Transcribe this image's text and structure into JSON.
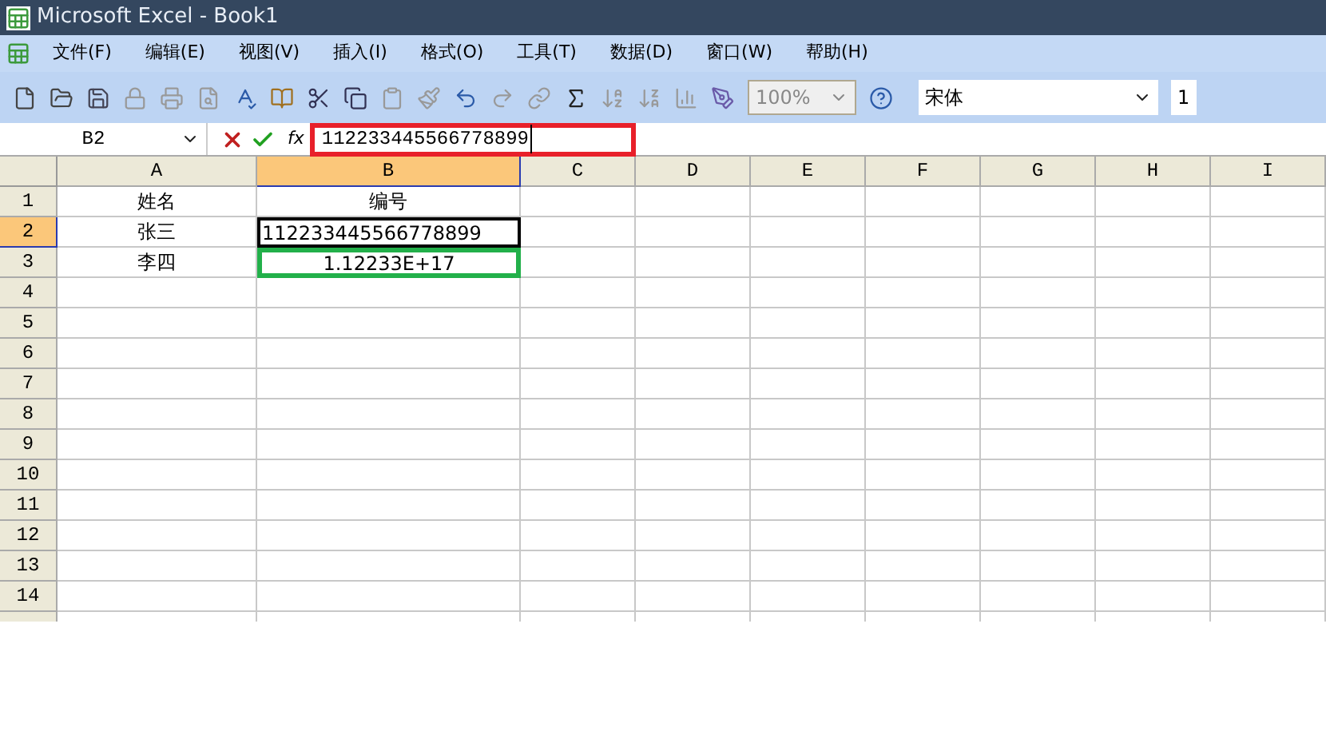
{
  "window": {
    "title": "Microsoft Excel - Book1"
  },
  "menu": [
    "文件(F)",
    "编辑(E)",
    "视图(V)",
    "插入(I)",
    "格式(O)",
    "工具(T)",
    "数据(D)",
    "窗口(W)",
    "帮助(H)"
  ],
  "toolbar": {
    "zoom": "100%",
    "font": "宋体",
    "font_size": "1"
  },
  "formula_bar": {
    "name_box": "B2",
    "fx": "fx",
    "value": "112233445566778899",
    "highlighted": true
  },
  "columns": [
    {
      "label": "A",
      "selected": false
    },
    {
      "label": "B",
      "selected": true
    },
    {
      "label": "C",
      "selected": false
    },
    {
      "label": "D",
      "selected": false
    },
    {
      "label": "E",
      "selected": false
    },
    {
      "label": "F",
      "selected": false
    },
    {
      "label": "G",
      "selected": false
    },
    {
      "label": "H",
      "selected": false
    },
    {
      "label": "I",
      "selected": false
    }
  ],
  "rows": [
    {
      "label": "1",
      "selected": false,
      "cells": [
        {
          "text": "姓名"
        },
        {
          "text": "编号"
        }
      ]
    },
    {
      "label": "2",
      "selected": true,
      "cells": [
        {
          "text": "张三"
        },
        {
          "text": "112233445566778899",
          "active": true
        }
      ]
    },
    {
      "label": "3",
      "selected": false,
      "cells": [
        {
          "text": "李四"
        },
        {
          "text": "1.12233E+17",
          "highlighted": true
        }
      ]
    },
    {
      "label": "4",
      "selected": false,
      "cells": []
    },
    {
      "label": "5",
      "selected": false,
      "cells": []
    },
    {
      "label": "6",
      "selected": false,
      "cells": []
    },
    {
      "label": "7",
      "selected": false,
      "cells": []
    },
    {
      "label": "8",
      "selected": false,
      "cells": []
    },
    {
      "label": "9",
      "selected": false,
      "cells": []
    },
    {
      "label": "10",
      "selected": false,
      "cells": []
    },
    {
      "label": "11",
      "selected": false,
      "cells": []
    },
    {
      "label": "12",
      "selected": false,
      "cells": []
    },
    {
      "label": "13",
      "selected": false,
      "cells": []
    },
    {
      "label": "14",
      "selected": false,
      "cells": []
    }
  ]
}
